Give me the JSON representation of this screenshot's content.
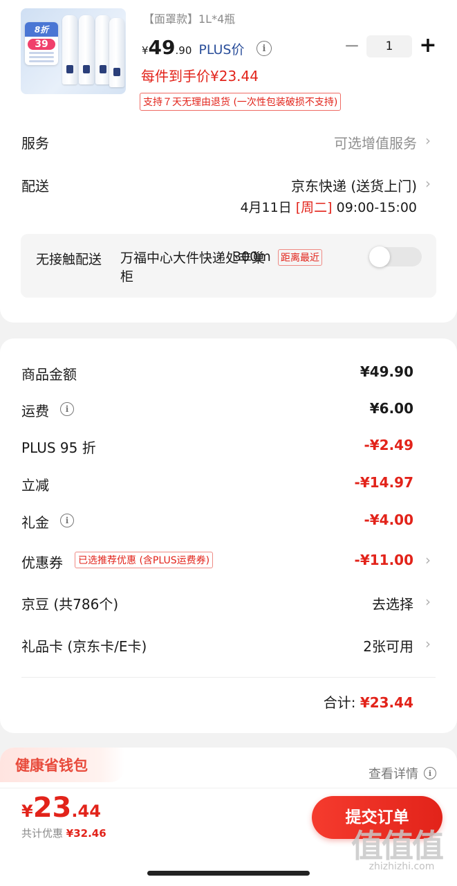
{
  "product": {
    "variant": "【面罩款】1L*4瓶",
    "price_yen": "¥",
    "price_int": "49",
    "price_dec": ".90",
    "plus_price_label": "PLUS价",
    "quantity": "1",
    "minus_symbol": "−",
    "plus_symbol": "+",
    "per_item_price": "每件到手价¥23.44",
    "return_policy": "支持７天无理由退货 (一次性包装破损不支持)",
    "thumbnail_promo_top": "8折",
    "thumbnail_promo_price": "39"
  },
  "service": {
    "label": "服务",
    "value": "可选增值服务"
  },
  "delivery": {
    "label": "配送",
    "method": "京东快递 (送货上门)",
    "date": "4月11日",
    "weekday": "[周二]",
    "time": "09:00-15:00"
  },
  "contactless": {
    "title": "无接触配送",
    "place": "万福中心大件快递处丰巢柜",
    "distance": "300m",
    "tag": "距离最近",
    "toggle_on": false
  },
  "amounts": {
    "goods_label": "商品金额",
    "goods_value": "¥49.90",
    "shipping_label": "运费",
    "shipping_value": "¥6.00",
    "plus_label": "PLUS 95 折",
    "plus_value": "-¥2.49",
    "instant_label": "立减",
    "instant_value": "-¥14.97",
    "gift_label": "礼金",
    "gift_value": "-¥4.00",
    "coupon_label": "优惠券",
    "coupon_tag": "已选推荐优惠 (含PLUS运费券)",
    "coupon_value": "-¥11.00",
    "beans_label": "京豆 (共786个)",
    "beans_value": "去选择",
    "giftcard_label": "礼品卡 (京东卡/E卡)",
    "giftcard_value": "2张可用",
    "total_label": "合计:",
    "total_value": "¥23.44"
  },
  "wallet": {
    "title": "健康省钱包",
    "detail_link": "查看详情"
  },
  "bottom": {
    "yen": "¥",
    "price_int": "23",
    "price_dec": ".44",
    "savings_label": "共计优惠",
    "savings_value": "¥32.46",
    "submit_label": "提交订单"
  },
  "watermark": {
    "glyphs": "值值值",
    "url": "zhizhizhi.com"
  },
  "colors": {
    "accent_red": "#e2231a",
    "plus_blue": "#2a4e9a"
  }
}
